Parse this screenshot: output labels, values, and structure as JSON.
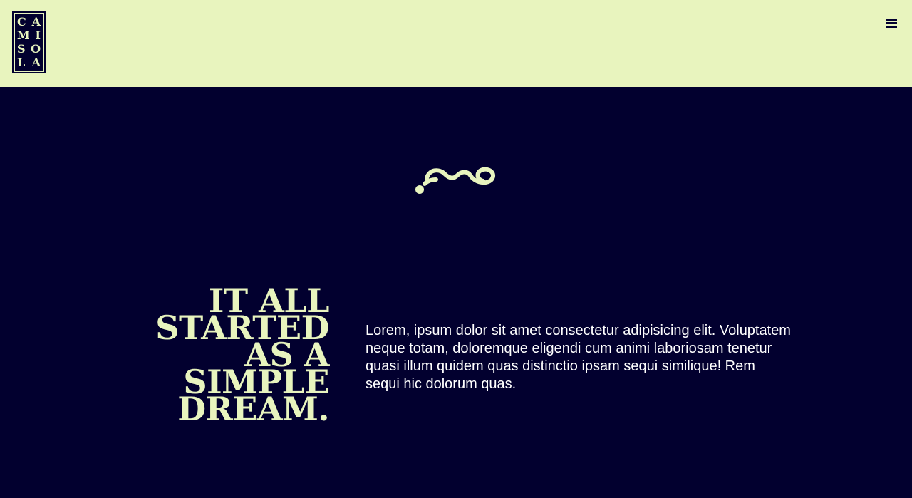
{
  "header": {
    "logo": {
      "alt": "CAMISOLA",
      "rows": [
        [
          "C",
          "A"
        ],
        [
          "M",
          "I"
        ],
        [
          "S",
          "O"
        ],
        [
          "L",
          "A"
        ]
      ]
    },
    "menu_icon": "hamburger-menu-icon"
  },
  "hero": {
    "ornament_icon": "flourish-ornament-icon",
    "headline_lines": [
      "IT ALL",
      "STARTED",
      "AS A",
      "SIMPLE",
      "DREAM."
    ],
    "paragraph": "Lorem, ipsum dolor sit amet consectetur adipisicing elit. Voluptatem neque totam, doloremque eligendi cum animi laboriosam tenetur quasi illum quidem quas distinctio ipsam sequi similique! Rem sequi hic dolorum quas."
  },
  "colors": {
    "header_bg": "#e8f4be",
    "page_bg": "#02002f",
    "accent": "#e8f4be",
    "text": "#ffffff"
  }
}
